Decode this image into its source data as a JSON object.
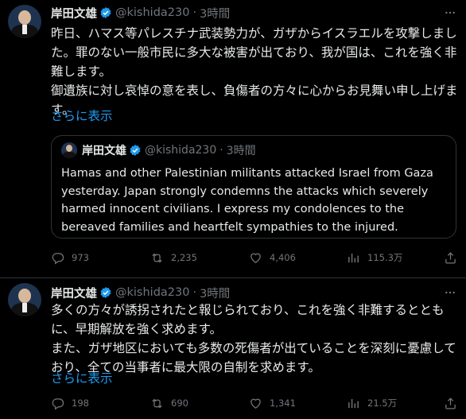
{
  "tweets": [
    {
      "author": {
        "name": "岸田文雄",
        "handle": "@kishida230",
        "time": "3時間"
      },
      "text": "昨日、ハマス等パレスチナ武装勢力が、ガザからイスラエルを攻撃しました。罪のない一般市民に多大な被害が出ており、我が国は、これを強く非難します。\n御遺族に対し哀悼の意を表し、負傷者の方々に心からお見舞い申し上げます。",
      "show_more": "さらに表示",
      "quote": {
        "author": {
          "name": "岸田文雄",
          "handle": "@kishida230",
          "time": "3時間"
        },
        "text": "Hamas and other Palestinian militants attacked Israel from Gaza yesterday. Japan strongly condemns the attacks which severely harmed innocent civilians. I express my condolences to the bereaved families and heartfelt sympathies to the injured."
      },
      "stats": {
        "replies": "973",
        "reposts": "2,235",
        "likes": "4,406",
        "views": "115.3万"
      }
    },
    {
      "author": {
        "name": "岸田文雄",
        "handle": "@kishida230",
        "time": "3時間"
      },
      "text": "多くの方々が誘拐されたと報じられており、これを強く非難するとともに、早期解放を強く求めます。\nまた、ガザ地区においても多数の死傷者が出ていることを深刻に憂慮しており、全ての当事者に最大限の自制を求めます。",
      "show_more": "さらに表示",
      "stats": {
        "replies": "198",
        "reposts": "690",
        "likes": "1,341",
        "views": "21.5万"
      }
    }
  ],
  "colors": {
    "accent": "#1d9bf0",
    "muted": "#71767b",
    "text": "#e7e9ea",
    "background": "#000000",
    "border": "#2f3336"
  },
  "icons": [
    "verified-badge-icon",
    "more-options-icon",
    "reply-icon",
    "repost-icon",
    "like-icon",
    "views-icon",
    "share-icon"
  ]
}
